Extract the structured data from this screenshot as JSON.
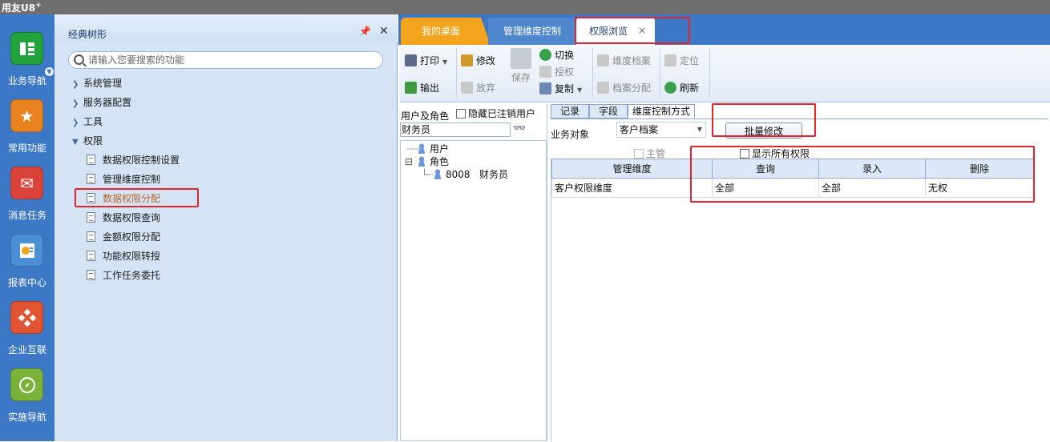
{
  "app": {
    "brand": "用友U8",
    "brand_sup": "+"
  },
  "rail": {
    "items": [
      {
        "label": "业务导航",
        "icon": "org-chart-icon",
        "color": "#22a23a"
      },
      {
        "label": "常用功能",
        "icon": "star-icon",
        "color": "#e8831f"
      },
      {
        "label": "消息任务",
        "icon": "mail-icon",
        "color": "#d9433a"
      },
      {
        "label": "报表中心",
        "icon": "report-icon",
        "color": "#4b8fd6"
      },
      {
        "label": "企业互联",
        "icon": "network-icon",
        "color": "#e05333"
      },
      {
        "label": "实施导航",
        "icon": "compass-icon",
        "color": "#7bb33a"
      }
    ]
  },
  "tree": {
    "title": "经典树形",
    "search_placeholder": "请输入您要搜索的功能",
    "top_nodes": [
      "系统管理",
      "服务器配置",
      "工具",
      "权限"
    ],
    "permission_children": [
      "数据权限控制设置",
      "管理维度控制",
      "数据权限分配",
      "数据权限查询",
      "金额权限分配",
      "功能权限转授",
      "工作任务委托"
    ]
  },
  "tabs": {
    "desktop": "我的桌面",
    "dimension": "管理维度控制",
    "browse": "权限浏览",
    "close": "×"
  },
  "toolbar": {
    "print": "打印",
    "export": "输出",
    "edit": "修改",
    "discard": "放弃",
    "save": "保存",
    "switch": "切换",
    "authorize": "授权",
    "copy": "复制",
    "dim_archive": "维度档案",
    "archive_assign": "档案分配",
    "locate": "定位",
    "refresh": "刷新"
  },
  "users_panel": {
    "label": "用户及角色",
    "hide_cancelled": "隐藏已注销用户",
    "filter_value": "财务员",
    "tree": {
      "user": "用户",
      "role": "角色",
      "role_code": "8008",
      "role_name": "财务员"
    }
  },
  "subtabs": [
    "记录",
    "字段",
    "维度控制方式"
  ],
  "content": {
    "business_object_label": "业务对象",
    "business_object_value": "客户档案",
    "batch_edit": "批量修改",
    "supervisor": "主管",
    "show_all": "显示所有权限",
    "columns": [
      "管理维度",
      "查询",
      "录入",
      "删除"
    ],
    "rows": [
      {
        "dimension": "客户权限维度",
        "query": "全部",
        "entry": "全部",
        "delete": "无权"
      }
    ]
  }
}
